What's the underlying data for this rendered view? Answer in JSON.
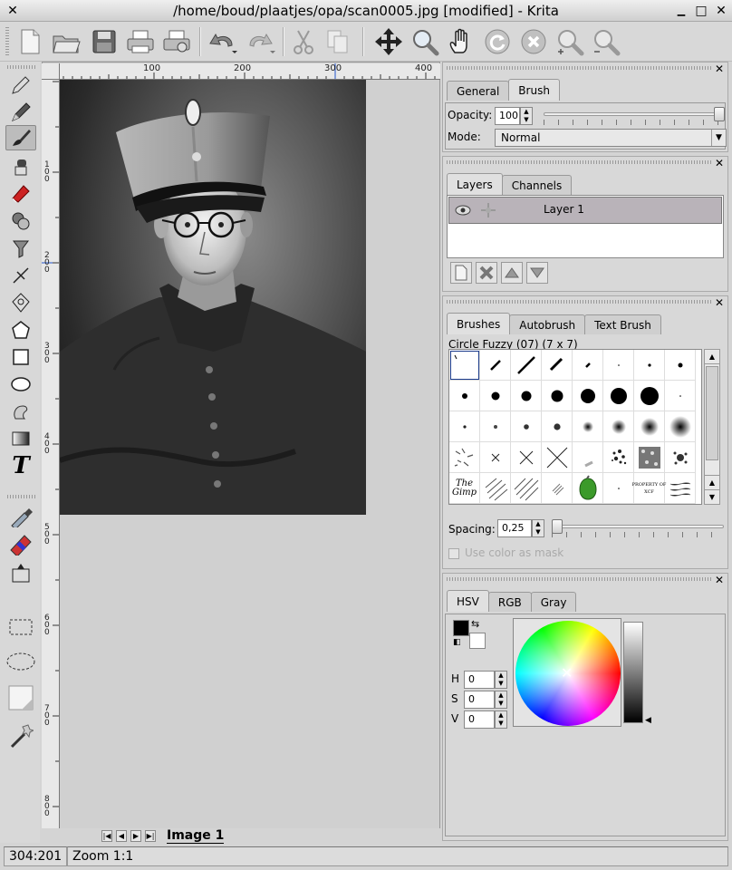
{
  "window": {
    "title": "/home/boud/plaatjes/opa/scan0005.jpg [modified] - Krita",
    "close": "✕",
    "minimize": "▁",
    "maximize": "□",
    "wclose": "✕"
  },
  "toolbar": {
    "icons": [
      "new-document-icon",
      "open-folder-icon",
      "save-disk-icon",
      "print-icon",
      "print-preview-icon",
      "undo-icon",
      "redo-icon",
      "cut-icon",
      "copy-icon",
      "move-icon",
      "zoom-icon",
      "pan-hand-icon",
      "refresh-icon",
      "stop-icon",
      "zoom-in-icon",
      "zoom-out-icon"
    ]
  },
  "rulers": {
    "h": [
      "100",
      "200",
      "300",
      "400"
    ],
    "v": [
      "100",
      "200",
      "300",
      "400",
      "500",
      "600",
      "700",
      "800"
    ]
  },
  "image_tab": "Image 1",
  "status": {
    "coords": "304:201",
    "zoom": "Zoom 1:1"
  },
  "brush_panel": {
    "tabs": [
      "General",
      "Brush"
    ],
    "opacity_label": "Opacity:",
    "opacity_value": "100",
    "opacity_level": 1.0,
    "mode_label": "Mode:",
    "mode_value": "Normal"
  },
  "layers_panel": {
    "tabs": [
      "Layers",
      "Channels"
    ],
    "layer_name": "Layer 1"
  },
  "brushes_panel": {
    "tabs": [
      "Brushes",
      "Autobrush",
      "Text Brush"
    ],
    "current": "Circle Fuzzy (07) (7 x 7)",
    "spacing_label": "Spacing:",
    "spacing_value": "0,25",
    "spacing_level": 0.0,
    "mask_label": "Use color as mask",
    "gimp_text": "The\nGimp",
    "xcf_text": "PROPERTY OF\nXCF"
  },
  "color_panel": {
    "tabs": [
      "HSV",
      "RGB",
      "Gray"
    ],
    "h_label": "H",
    "h_value": "0",
    "s_label": "S",
    "s_value": "0",
    "v_label": "V",
    "v_value": "0",
    "fg": "#000000",
    "bg": "#ffffff"
  }
}
